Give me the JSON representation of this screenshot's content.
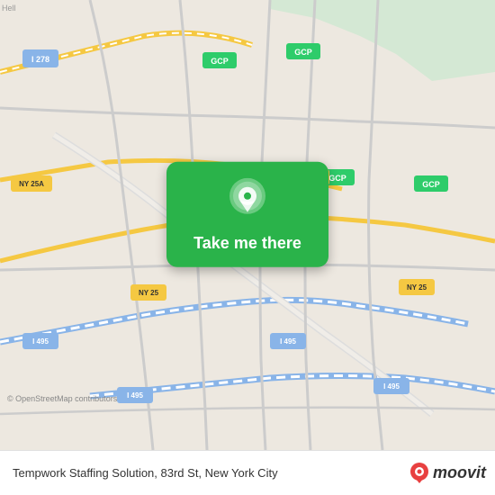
{
  "map": {
    "background_color": "#e8e0d8"
  },
  "button": {
    "label": "Take me there"
  },
  "bottom_bar": {
    "location": "Tempwork Staffing Solution, 83rd St, New York City",
    "copyright": "© OpenStreetMap contributors",
    "brand": "moovit"
  }
}
